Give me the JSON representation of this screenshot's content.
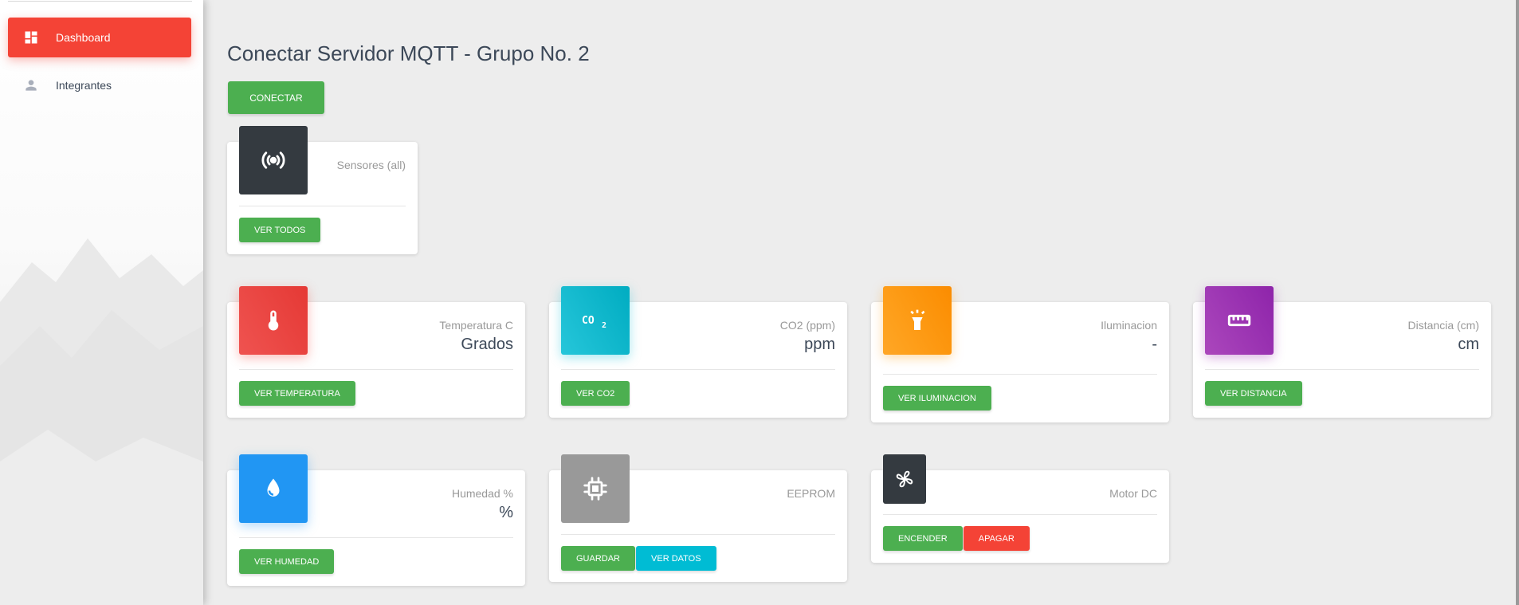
{
  "sidebar": {
    "items": [
      {
        "label": "Dashboard",
        "icon": "dashboard-icon",
        "active": true
      },
      {
        "label": "Integrantes",
        "icon": "person-icon",
        "active": false
      }
    ]
  },
  "main": {
    "title": "Conectar Servidor MQTT - Grupo No. 2",
    "connect_label": "CONECTAR"
  },
  "cards": {
    "sensores": {
      "label": "Sensores (all)",
      "button": "VER TODOS",
      "icon": "broadcast-icon"
    },
    "temperatura": {
      "label": "Temperatura C",
      "value": "Grados",
      "button": "VER TEMPERATURA",
      "icon": "thermometer-icon"
    },
    "co2": {
      "label": "CO2 (ppm)",
      "value": "ppm",
      "button": "VER CO2",
      "icon": "co2-icon"
    },
    "iluminacion": {
      "label": "Iluminacion",
      "value": "-",
      "button": "VER ILUMINACION",
      "icon": "flashlight-icon"
    },
    "distancia": {
      "label": "Distancia (cm)",
      "value": "cm",
      "button": "VER DISTANCIA",
      "icon": "ruler-icon"
    },
    "humedad": {
      "label": "Humedad %",
      "value": "%",
      "button": "VER HUMEDAD",
      "icon": "water-drop-icon"
    },
    "eeprom": {
      "label": "EEPROM",
      "button_save": "GUARDAR",
      "button_view": "VER DATOS",
      "icon": "chip-icon"
    },
    "motor": {
      "label": "Motor DC",
      "button_on": "ENCENDER",
      "button_off": "APAGAR",
      "icon": "fan-icon"
    }
  },
  "colors": {
    "accent_red": "#f44336",
    "green": "#4caf50",
    "cyan": "#00bcd4",
    "orange": "#ff9800",
    "purple": "#9c27b0",
    "blue": "#2196f3",
    "dark": "#343a40",
    "grey": "#999999"
  }
}
